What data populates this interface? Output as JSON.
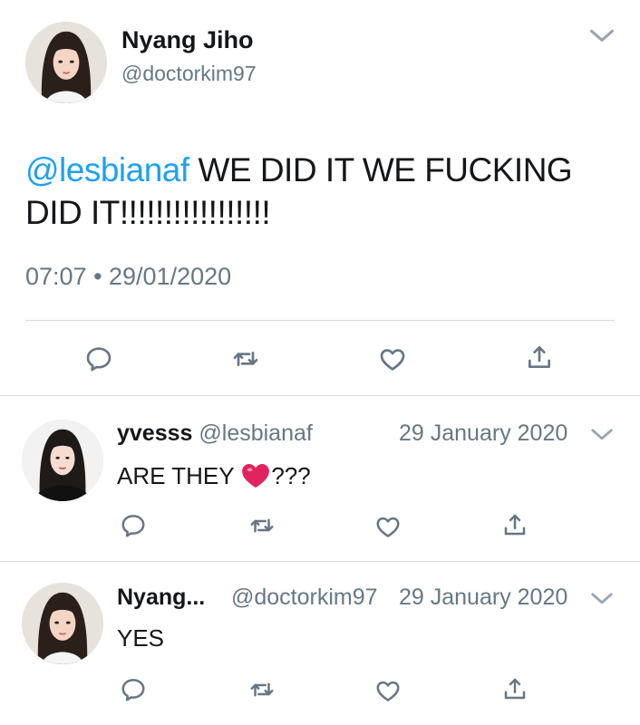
{
  "main_tweet": {
    "display_name": "Nyang Jiho",
    "handle": "@doctorkim97",
    "mention": "@lesbianaf",
    "text_line1": "WE DID IT WE FUCKING",
    "text_line2": "DID IT!!!!!!!!!!!!!!!!!",
    "timestamp": "07:07 • 29/01/2020",
    "icons": [
      "reply-icon",
      "retweet-icon",
      "like-icon",
      "share-icon",
      "chevron-down-icon"
    ]
  },
  "replies": [
    {
      "display_name": "yvesss",
      "handle": "@lesbianaf",
      "date": "29 January 2020",
      "text_before": "ARE THEY",
      "emoji": "heart-emoji",
      "text_after": "???"
    },
    {
      "display_name": "Nyang...",
      "handle": "@doctorkim97",
      "date": "29 January 2020",
      "text": "YES"
    }
  ],
  "colors": {
    "accent": "#1da1f2",
    "muted": "#657786",
    "divider": "#d8dde2",
    "icon": "#657786",
    "heart": "#e0245e"
  }
}
